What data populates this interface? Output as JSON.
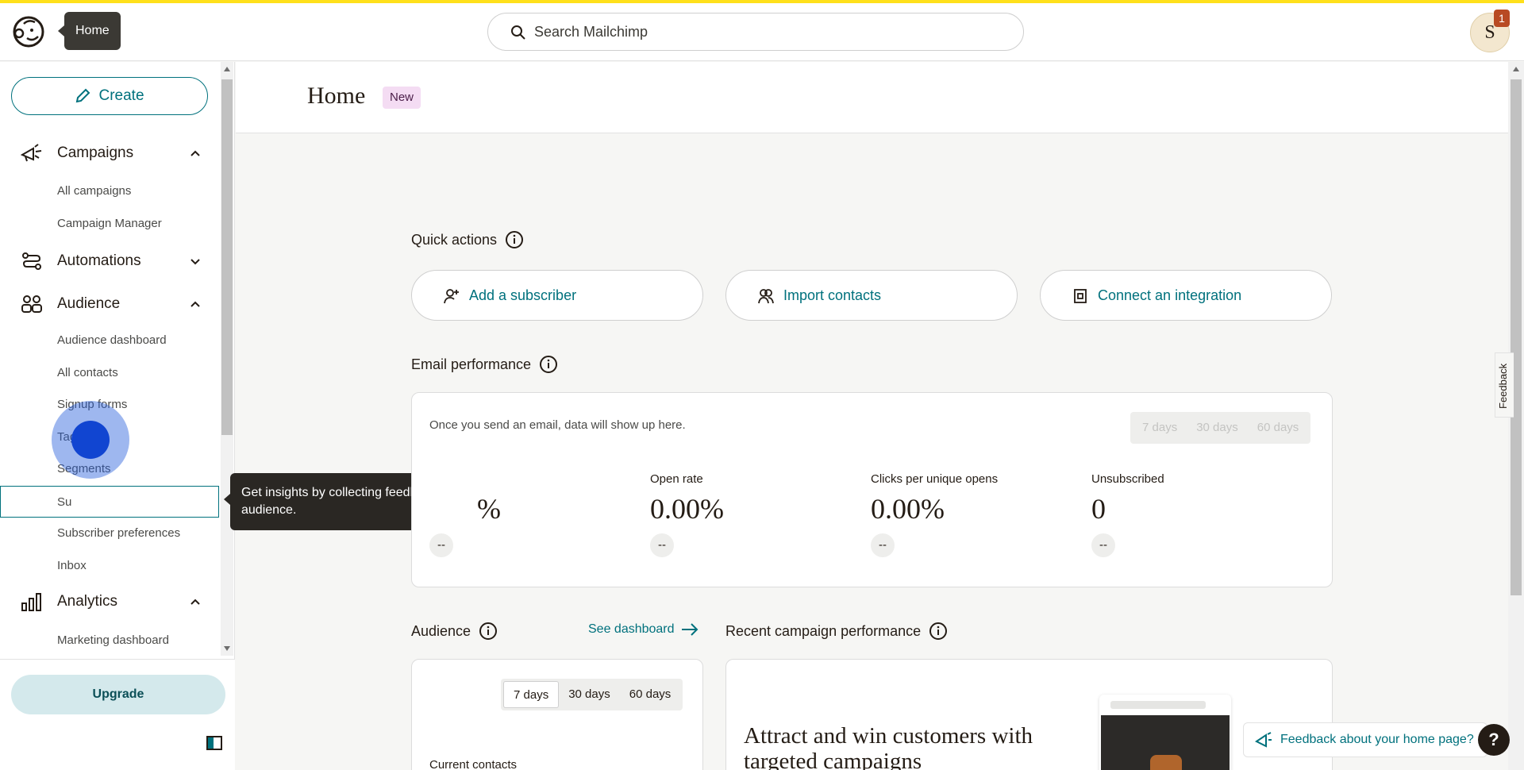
{
  "topbar": {
    "home_tooltip": "Home",
    "search_placeholder": "Search Mailchimp",
    "avatar_initial": "S",
    "notification_count": "1"
  },
  "sidebar": {
    "create_label": "Create",
    "campaigns": {
      "label": "Campaigns",
      "children": [
        "All campaigns",
        "Campaign Manager"
      ]
    },
    "automations": {
      "label": "Automations"
    },
    "audience": {
      "label": "Audience",
      "children": [
        "Audience dashboard",
        "All contacts",
        "Signup forms",
        "Tags",
        "Segments",
        "Surveys",
        "Subscriber preferences",
        "Inbox"
      ],
      "selected_visible_text": "Su"
    },
    "analytics": {
      "label": "Analytics",
      "children": [
        "Marketing dashboard"
      ]
    },
    "upgrade_label": "Upgrade",
    "surveys_tooltip": "Get insights by collecting feedback from your audience."
  },
  "page": {
    "title": "Home",
    "badge": "New",
    "feedback_tab": "Feedback"
  },
  "quick_actions": {
    "title": "Quick actions",
    "buttons": [
      "Add a subscriber",
      "Import contacts",
      "Connect an integration"
    ]
  },
  "email_performance": {
    "title": "Email performance",
    "note": "Once you send an email, data will show up here.",
    "ranges": [
      "7 days",
      "30 days",
      "60 days"
    ],
    "metrics": [
      {
        "label": "Open rate",
        "value": "0.00%",
        "delta": "--"
      },
      {
        "label": "Clicks per unique opens",
        "value": "0.00%",
        "delta": "--"
      },
      {
        "label": "Unsubscribed",
        "value": "0",
        "delta": "--"
      }
    ],
    "hidden_metric": {
      "value_fragment": "%",
      "delta": "--"
    }
  },
  "audience_section": {
    "title": "Audience",
    "see_dashboard": "See dashboard",
    "ranges": [
      "7 days",
      "30 days",
      "60 days"
    ],
    "active_range": "7 days",
    "current_contacts": "Current contacts"
  },
  "recent_campaign": {
    "title": "Recent campaign performance",
    "promo_title": "Attract and win customers with targeted campaigns"
  },
  "footer": {
    "feedback_home": "Feedback about your home page?",
    "help": "?"
  },
  "colors": {
    "accent": "#00717d",
    "brand_yellow": "#ffe01b",
    "text": "#241c15"
  }
}
